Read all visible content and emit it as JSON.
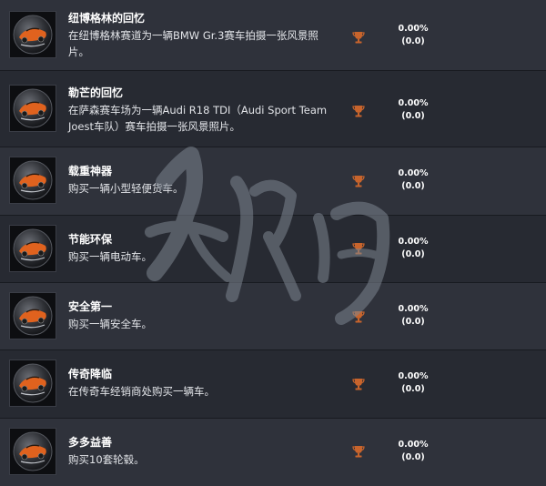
{
  "trophies": [
    {
      "title": "纽博格林的回忆",
      "desc": "在纽博格林赛道为一辆BMW Gr.3赛车拍摄一张风景照片。",
      "percent": "0.00%",
      "value": "(0.0)"
    },
    {
      "title": "勒芒的回忆",
      "desc": "在萨森赛车场为一辆Audi R18 TDI（Audi Sport Team Joest车队）赛车拍摄一张风景照片。",
      "percent": "0.00%",
      "value": "(0.0)"
    },
    {
      "title": "载重神器",
      "desc": "购买一辆小型轻便货车。",
      "percent": "0.00%",
      "value": "(0.0)"
    },
    {
      "title": "节能环保",
      "desc": "购买一辆电动车。",
      "percent": "0.00%",
      "value": "(0.0)"
    },
    {
      "title": "安全第一",
      "desc": "购买一辆安全车。",
      "percent": "0.00%",
      "value": "(0.0)"
    },
    {
      "title": "传奇降临",
      "desc": "在传奇车经销商处购买一辆车。",
      "percent": "0.00%",
      "value": "(0.0)"
    },
    {
      "title": "多多益善",
      "desc": "购买10套轮毂。",
      "percent": "0.00%",
      "value": "(0.0)"
    }
  ],
  "colors": {
    "trophy_bronze": "#c8642c",
    "row_light": "#2f323b",
    "row_dark": "#272a32",
    "badge_orange": "#e0621e"
  },
  "icons": {
    "thumb": "race-car-badge-icon",
    "trophy": "bronze-trophy-icon"
  }
}
